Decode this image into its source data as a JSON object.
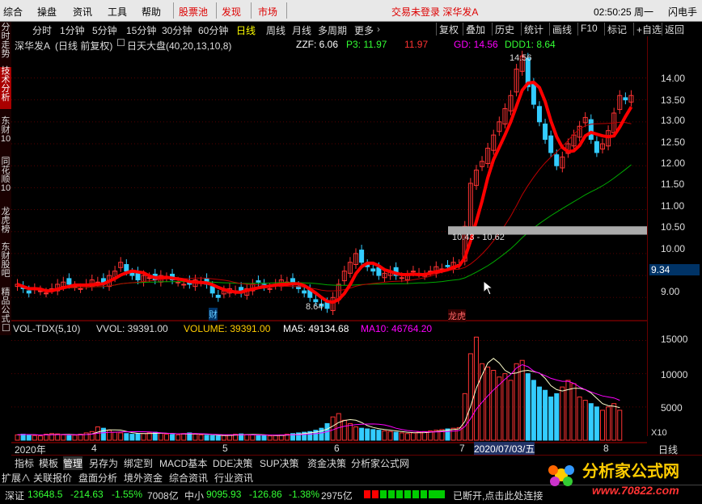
{
  "menu": {
    "items": [
      "综合",
      "操盘",
      "资讯",
      "工具",
      "帮助"
    ],
    "red_items": [
      "股票池",
      "发现",
      "市场"
    ],
    "notice": "交易未登录 深华发A",
    "clock": "02:50:25 周一",
    "flash": "闪电手"
  },
  "left_tabs": [
    "分时走势",
    "技术分析",
    "东财10",
    "同花顺10",
    "龙虎榜",
    "东财股吧",
    "精品公式"
  ],
  "periods": [
    "分时",
    "1分钟",
    "5分钟",
    "15分钟",
    "30分钟",
    "60分钟",
    "日线",
    "周线",
    "月线",
    "多周期",
    "更多"
  ],
  "selected_period": "日线",
  "right_buttons": [
    "复权",
    "叠加",
    "历史",
    "统计",
    "F10",
    "标记",
    "+自选",
    "返回"
  ],
  "right_buttons2": [
    "画线"
  ],
  "chart_header": {
    "stock": "深华发A",
    "mode": "(日线 前复权)",
    "indicator_name": "日天大盘(40,20,13,10,8)",
    "zzf": "ZZF: 6.06",
    "p3": "P3: 11.97",
    "p3b": "11.97",
    "gd": "GD: 14.56",
    "ddd1": "DDD1: 8.64"
  },
  "annotations": {
    "high": "14.56",
    "low": "8.64",
    "range": "10.43 - 10.62",
    "cai": "财",
    "lhb": "龙虎",
    "price_tag": "9.34"
  },
  "price_axis": [
    "14.00",
    "13.50",
    "13.00",
    "12.50",
    "12.00",
    "11.50",
    "11.00",
    "10.50",
    "10.00",
    "9.50",
    "9.00"
  ],
  "vol_header": {
    "name": "VOL-TDX(5,10)",
    "vvol": "VVOL: 39391.00",
    "volume": "VOLUME: 39391.00",
    "ma5": "MA5: 49134.68",
    "ma10": "MA10: 46764.20"
  },
  "vol_axis": [
    "15000",
    "10000",
    "5000"
  ],
  "vol_unit": "X10",
  "date_axis": {
    "year": "2020年",
    "months": [
      "4",
      "5",
      "6",
      "7",
      "8"
    ],
    "cursor_date": "2020/07/03/五",
    "period_label": "日线"
  },
  "bottom_tabs": [
    "指标",
    "模板",
    "管理",
    "另存为",
    "绑定到",
    "MACD基本",
    "DDE决策",
    "SUP决策",
    "资金决策",
    "分析家公式网"
  ],
  "ext_tabs": [
    "扩展∧",
    "关联报价",
    "盘面分析",
    "境外资金",
    "综合资讯",
    "行业资讯"
  ],
  "status": {
    "sz_name": "深证",
    "sz_val": "13648.5",
    "sz_chg": "-214.63",
    "sz_pct": "-1.55%",
    "sz_amt": "7008亿",
    "zx_name": "中小",
    "zx_val": "9095.93",
    "zx_chg": "-126.86",
    "zx_pct": "-1.38%",
    "zx_amt": "2975亿",
    "msg": "已断开,点击此处连接"
  },
  "logo": {
    "name": "分析家公式网",
    "url": "www.70822.com"
  },
  "chart_data": {
    "type": "candlestick",
    "ylim": [
      8.6,
      14.8
    ],
    "close": [
      9.3,
      9.2,
      9.1,
      9.2,
      9.15,
      9.1,
      9.2,
      9.3,
      9.35,
      9.3,
      9.25,
      9.2,
      9.3,
      9.4,
      9.35,
      9.3,
      9.5,
      9.6,
      9.8,
      9.6,
      9.5,
      9.4,
      9.5,
      9.45,
      9.4,
      9.5,
      9.45,
      9.4,
      9.35,
      9.3,
      9.3,
      9.4,
      9.35,
      9.3,
      9.1,
      9.0,
      9.15,
      9.2,
      9.15,
      9.1,
      9.2,
      9.3,
      9.35,
      9.25,
      9.2,
      9.3,
      9.4,
      9.35,
      9.3,
      9.2,
      9.1,
      9.0,
      8.9,
      8.8,
      8.75,
      9.0,
      9.3,
      9.6,
      9.8,
      10.0,
      9.8,
      9.7,
      9.6,
      9.5,
      9.55,
      9.6,
      9.5,
      9.45,
      9.5,
      9.6,
      9.55,
      9.5,
      9.6,
      9.7,
      9.65,
      9.7,
      9.8,
      9.75,
      10.62,
      11.6,
      11.9,
      12.1,
      12.4,
      12.7,
      13.0,
      13.3,
      13.6,
      14.2,
      14.5,
      13.8,
      13.4,
      13.0,
      12.6,
      12.3,
      12.0,
      12.2,
      12.5,
      12.7,
      12.9,
      13.1,
      12.6,
      12.3,
      12.5,
      12.8,
      13.2,
      13.6,
      13.5,
      13.6
    ],
    "volume": [
      800,
      900,
      850,
      700,
      650,
      900,
      1000,
      950,
      800,
      700,
      750,
      900,
      1100,
      1300,
      2000,
      1800,
      1500,
      1200,
      1100,
      1000,
      900,
      950,
      1000,
      1100,
      1200,
      1050,
      900,
      850,
      800,
      1000,
      1100,
      900,
      800,
      750,
      700,
      650,
      700,
      800,
      900,
      950,
      850,
      800,
      750,
      700,
      650,
      700,
      800,
      900,
      1000,
      1100,
      1200,
      1300,
      1500,
      1800,
      2500,
      3500,
      4000,
      3000,
      2500,
      2000,
      1800,
      1700,
      1600,
      1500,
      1400,
      1300,
      1200,
      1100,
      1000,
      1100,
      1200,
      1300,
      1400,
      1500,
      1600,
      1700,
      1800,
      1900,
      7000,
      13000,
      15500,
      11500,
      11000,
      10500,
      9500,
      10000,
      9000,
      11500,
      12000,
      10000,
      9000,
      8000,
      7500,
      6500,
      7000,
      8000,
      9000,
      8500,
      6500,
      6000,
      5500,
      5000,
      4500,
      5000,
      5500,
      4500
    ]
  }
}
